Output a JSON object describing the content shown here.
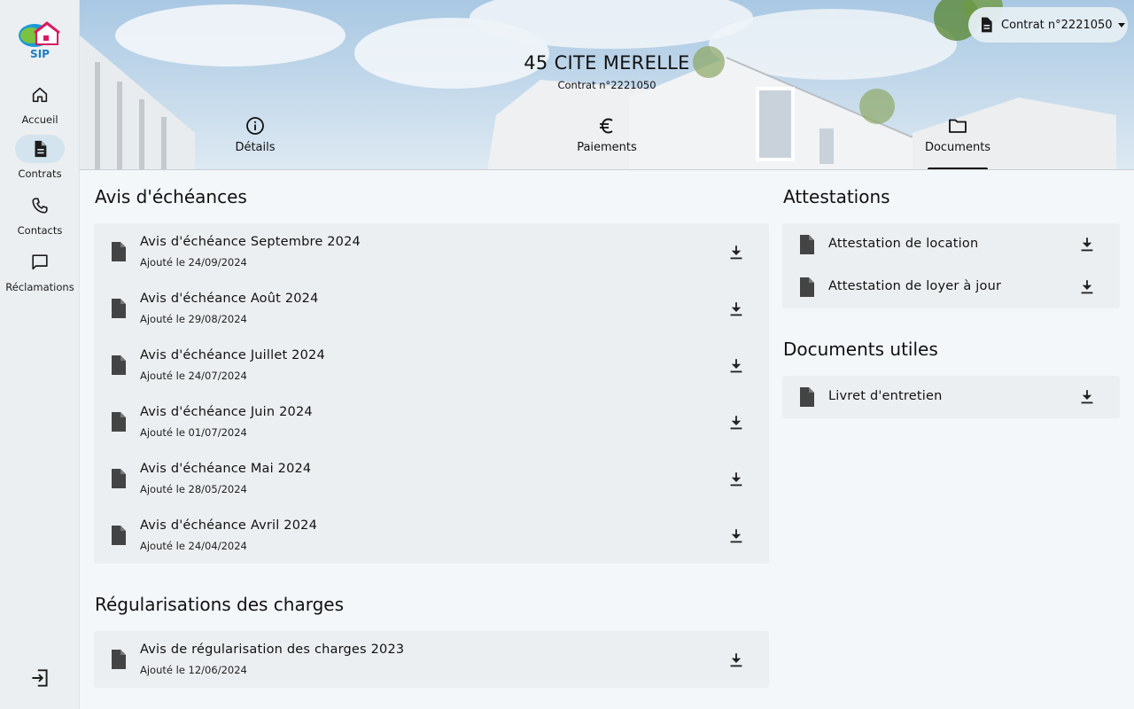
{
  "logo": {
    "text": "SIP"
  },
  "sidebar": {
    "items": [
      {
        "label": "Accueil",
        "icon": "home-icon"
      },
      {
        "label": "Contrats",
        "icon": "document-icon",
        "active": true
      },
      {
        "label": "Contacts",
        "icon": "phone-icon"
      },
      {
        "label": "Réclamations",
        "icon": "chat-icon"
      }
    ],
    "logout_icon": "logout-icon"
  },
  "header": {
    "title": "45 CITE MERELLE",
    "subtitle": "Contrat n°2221050",
    "contract_selector": "Contrat n°2221050",
    "tabs": [
      {
        "label": "Détails",
        "icon": "info-icon"
      },
      {
        "label": "Paiements",
        "icon": "euro-icon"
      },
      {
        "label": "Documents",
        "icon": "folder-icon",
        "active": true
      }
    ]
  },
  "avis": {
    "title": "Avis d'échéances",
    "items": [
      {
        "title": "Avis d'échéance Septembre 2024",
        "date": "Ajouté le 24/09/2024"
      },
      {
        "title": "Avis d'échéance Août 2024",
        "date": "Ajouté le 29/08/2024"
      },
      {
        "title": "Avis d'échéance Juillet 2024",
        "date": "Ajouté le 24/07/2024"
      },
      {
        "title": "Avis d'échéance Juin 2024",
        "date": "Ajouté le 01/07/2024"
      },
      {
        "title": "Avis d'échéance Mai 2024",
        "date": "Ajouté le 28/05/2024"
      },
      {
        "title": "Avis d'échéance Avril 2024",
        "date": "Ajouté le 24/04/2024"
      }
    ]
  },
  "regularisations": {
    "title": "Régularisations des charges",
    "items": [
      {
        "title": "Avis de régularisation des charges 2023",
        "date": "Ajouté le 12/06/2024"
      }
    ]
  },
  "attestations": {
    "title": "Attestations",
    "items": [
      {
        "title": "Attestation de location"
      },
      {
        "title": "Attestation de loyer à jour"
      }
    ]
  },
  "documents_utiles": {
    "title": "Documents utiles",
    "items": [
      {
        "title": "Livret d'entretien"
      }
    ]
  },
  "colors": {
    "sidebar_bg": "#eceff1",
    "card_bg": "#eceff1",
    "active_pill": "#d3e4ee",
    "page_bg": "#f3f7fa"
  }
}
